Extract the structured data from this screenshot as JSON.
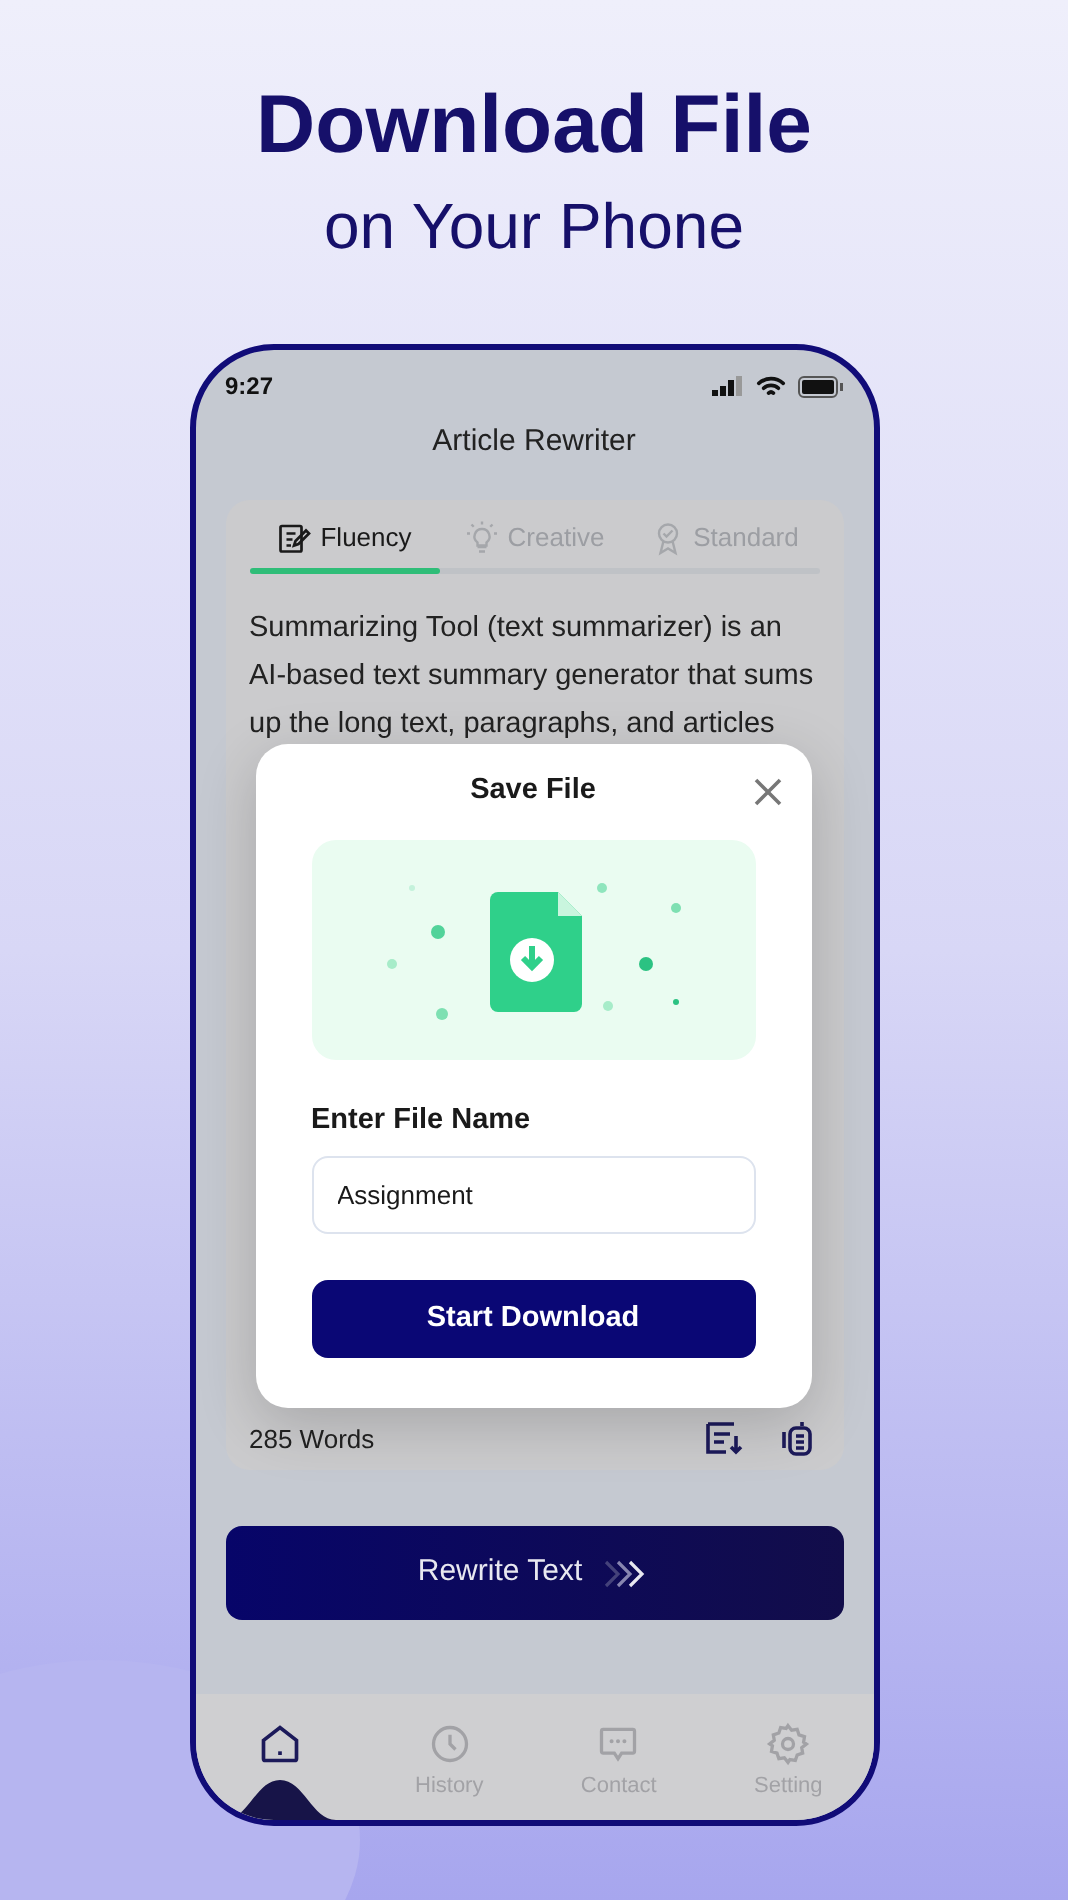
{
  "headline": {
    "title": "Download File",
    "subtitle": "on Your Phone"
  },
  "status_bar": {
    "time": "9:27"
  },
  "screen_title": "Article Rewriter",
  "tabs": [
    {
      "label": "Fluency",
      "selected": true
    },
    {
      "label": "Creative",
      "selected": false
    },
    {
      "label": "Standard",
      "selected": false
    }
  ],
  "article_lines": [
    "Summarizing Tool (text summarizer) is an",
    "AI-based text summary generator that sums",
    "up the long text, paragraphs, and articles"
  ],
  "word_count": "285 Words",
  "rewrite_button": "Rewrite Text",
  "dialog": {
    "title": "Save File",
    "field_label": "Enter File Name",
    "field_value": "Assignment",
    "button": "Start Download"
  },
  "nav": [
    {
      "selected": true
    },
    {
      "label": "History",
      "selected": false
    },
    {
      "label": "Contact",
      "selected": false
    },
    {
      "label": "Setting",
      "selected": false
    }
  ]
}
